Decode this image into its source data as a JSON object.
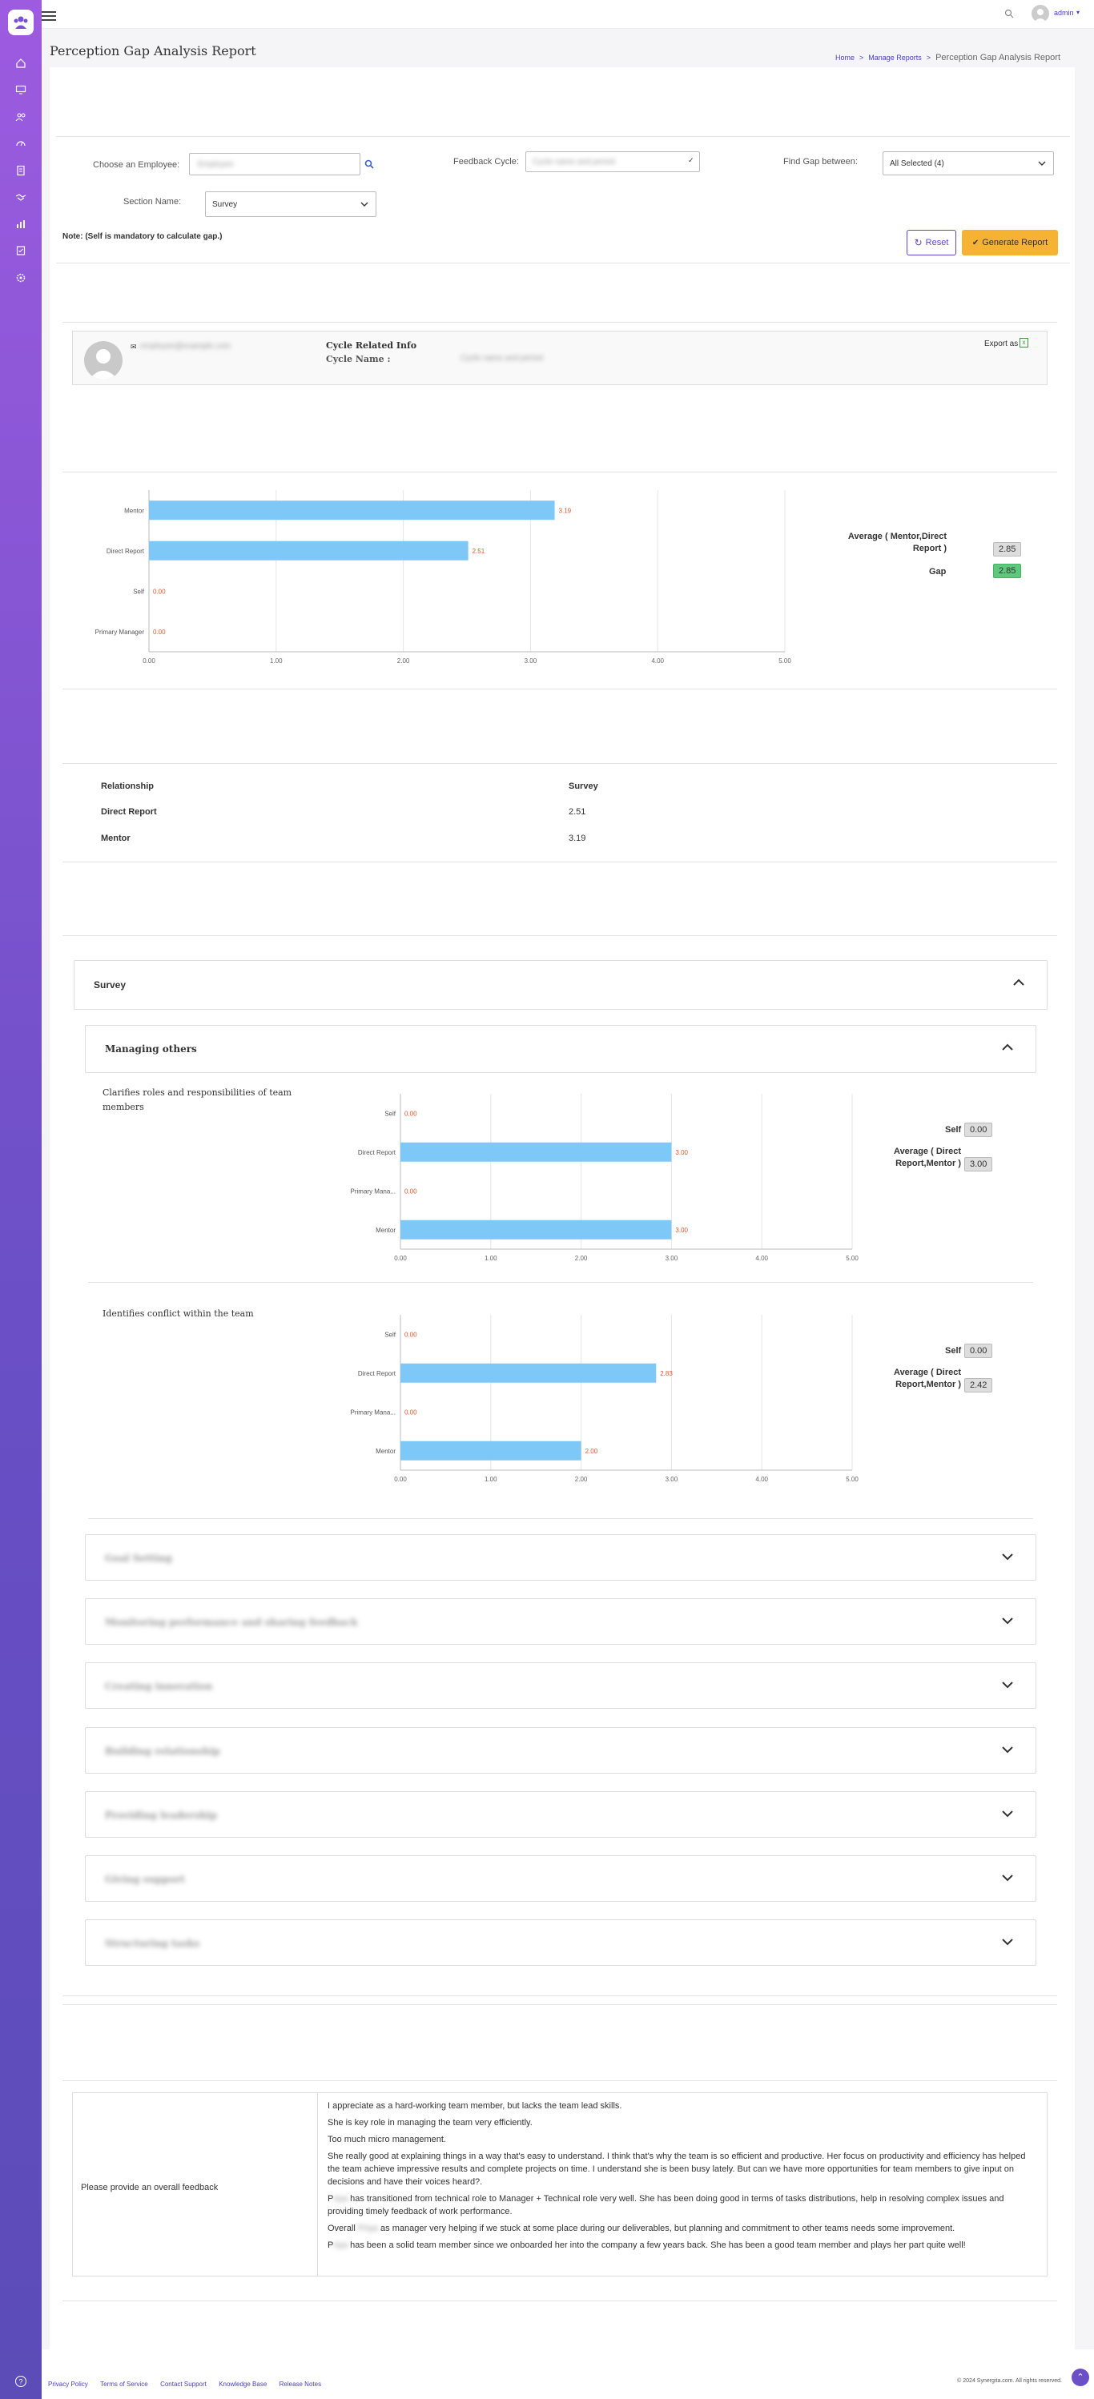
{
  "header": {
    "user": "admin"
  },
  "page": {
    "title": "Perception Gap Analysis Report"
  },
  "breadcrumb": {
    "home": "Home",
    "manage": "Manage Reports",
    "current": "Perception Gap Analysis Report"
  },
  "filters": {
    "employee_label": "Choose an Employee:",
    "employee_value": "Employee",
    "cycle_label": "Feedback Cycle:",
    "cycle_value": "Cycle name and period",
    "gap_label": "Find Gap between:",
    "gap_value": "All Selected (4)",
    "section_label": "Section Name:",
    "section_value": "Survey",
    "note": "Note: (Self is mandatory to calculate gap.)",
    "reset": "Reset",
    "generate": "Generate Report"
  },
  "employee_card": {
    "email": "employee@example.com",
    "cycle_heading": "Cycle Related Info",
    "cycle_name_label": "Cycle Name :",
    "cycle_name_value": "Cycle name and period",
    "export": "Export as"
  },
  "summary": {
    "avg_label": "Average ( Mentor,Direct Report )",
    "avg_value": "2.85",
    "gap_label": "Gap",
    "gap_value": "2.85"
  },
  "chart_data": [
    {
      "type": "bar",
      "orientation": "horizontal",
      "categories": [
        "Mentor",
        "Direct Report",
        "Self",
        "Primary Manager"
      ],
      "values": [
        3.19,
        2.51,
        0.0,
        0.0
      ],
      "xlim": [
        0,
        5
      ],
      "ticks": [
        "0.00",
        "1.00",
        "2.00",
        "3.00",
        "4.00",
        "5.00"
      ],
      "color": "#7ec8f7"
    },
    {
      "type": "bar",
      "orientation": "horizontal",
      "title": "Clarifies roles and responsibilities of team members",
      "categories": [
        "Self",
        "Direct Report",
        "Primary Mana...",
        "Mentor"
      ],
      "values": [
        0.0,
        3.0,
        0.0,
        3.0
      ],
      "xlim": [
        0,
        5
      ],
      "ticks": [
        "0.00",
        "1.00",
        "2.00",
        "3.00",
        "4.00",
        "5.00"
      ],
      "color": "#7ec8f7"
    },
    {
      "type": "bar",
      "orientation": "horizontal",
      "title": "Identifies conflict within the team",
      "categories": [
        "Self",
        "Direct Report",
        "Primary Mana...",
        "Mentor"
      ],
      "values": [
        0.0,
        2.83,
        0.0,
        2.0
      ],
      "xlim": [
        0,
        5
      ],
      "ticks": [
        "0.00",
        "1.00",
        "2.00",
        "3.00",
        "4.00",
        "5.00"
      ],
      "color": "#7ec8f7"
    }
  ],
  "relationship_table": {
    "headers": [
      "Relationship",
      "Survey"
    ],
    "rows": [
      [
        "Direct Report",
        "2.51"
      ],
      [
        "Mentor",
        "3.19"
      ]
    ]
  },
  "survey": {
    "title": "Survey",
    "group_title": "Managing others",
    "q1": {
      "title": "Clarifies roles and responsibilities of team members",
      "self_label": "Self",
      "self_value": "0.00",
      "avg_label": "Average ( Direct Report,Mentor )",
      "avg_value": "3.00"
    },
    "q2": {
      "title": "Identifies conflict within the team",
      "self_label": "Self",
      "self_value": "0.00",
      "avg_label": "Average ( Direct Report,Mentor )",
      "avg_value": "2.42"
    },
    "collapsed": [
      "Goal Setting",
      "Monitoring performance and sharing feedback",
      "Creating innovation",
      "Building relationship",
      "Providing leadership",
      "Giving support",
      "Structuring tasks"
    ]
  },
  "feedback": {
    "label": "Please provide an overall feedback",
    "items": [
      "I appreciate as a hard-working team member, but lacks the team lead skills.",
      "She is key role in managing the team very efficiently.",
      "Too much micro management.",
      "She really good at explaining things in a way that's easy to understand. I think that's why the team is so efficient and productive. Her focus on productivity and efficiency has helped the team achieve impressive results and complete projects on time. I understand she is been busy lately. But can we have more opportunities for team members to give input on decisions and have their voices heard?.",
      "has transitioned from technical role to Manager + Technical role very well. She has been doing good in terms of tasks distributions, help in resolving complex issues and providing timely feedback of work performance.",
      "as manager very helping if we stuck at some place during our deliverables, but planning and commitment to other teams needs some improvement.",
      "has been a solid team member since we onboarded her into the company a few years back. She has been a good team member and plays her part quite well!"
    ],
    "prefix_overall": "Overall",
    "prefix_name": "P"
  },
  "footer": {
    "links": [
      "Privacy Policy",
      "Terms of Service",
      "Contact Support",
      "Knowledge Base",
      "Release Notes"
    ],
    "copyright": "© 2024 Synergita.com. All rights reserved."
  }
}
